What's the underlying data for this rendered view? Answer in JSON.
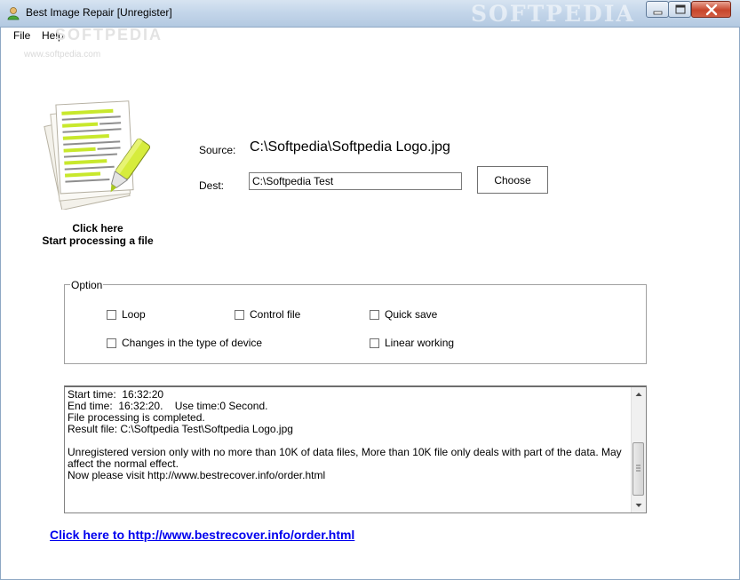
{
  "window": {
    "title": "Best Image Repair [Unregister]",
    "watermark": "SOFTPEDIA"
  },
  "menu": {
    "items": [
      "File",
      "Help"
    ]
  },
  "watermarks": {
    "menu": "SOFTPEDIA",
    "url": "www.softpedia.com"
  },
  "action": {
    "line1": "Click here",
    "line2": "Start processing a file"
  },
  "source": {
    "label": "Source:",
    "path": "C:\\Softpedia\\Softpedia Logo.jpg"
  },
  "dest": {
    "label": "Dest:",
    "value": "C:\\Softpedia Test",
    "choose_label": "Choose"
  },
  "options": {
    "title": "Option",
    "loop": "Loop",
    "control_file": "Control file",
    "quick_save": "Quick save",
    "changes_device": "Changes in the type of device",
    "linear_working": "Linear working"
  },
  "log": {
    "text": "Start time:  16:32:20\nEnd time:  16:32:20.    Use time:0 Second.\nFile processing is completed.\nResult file: C:\\Softpedia Test\\Softpedia Logo.jpg\n\nUnregistered version only with no more than 10K of data files, More than 10K file only deals with part of the data. May affect the normal effect.\nNow please visit http://www.bestrecover.info/order.html"
  },
  "link": {
    "label": "Click here to http://www.bestrecover.info/order.html"
  },
  "colors": {
    "link": "#0000ee",
    "titlebar": "#c4d6ea",
    "highlighter": "#c8e82c"
  }
}
